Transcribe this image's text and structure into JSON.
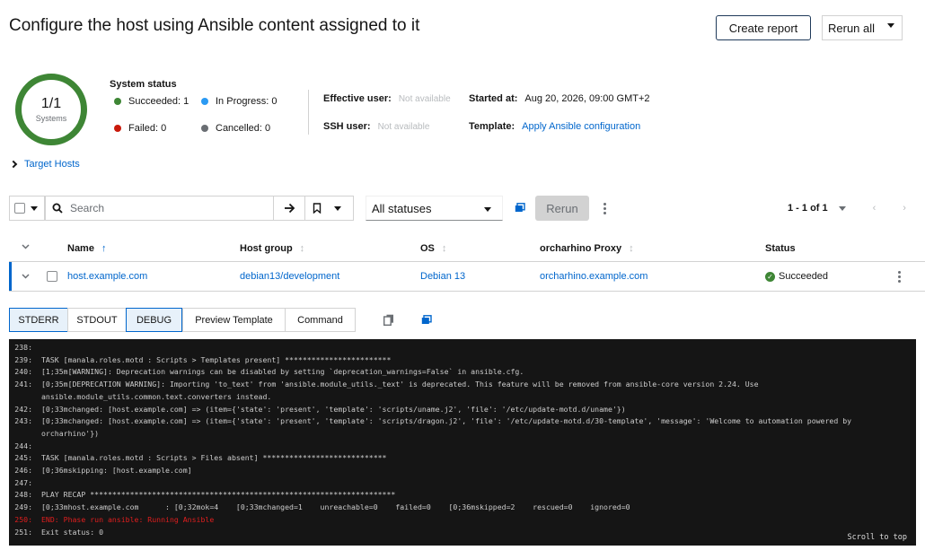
{
  "header": {
    "title": "Configure the host using Ansible content assigned to it",
    "create_report": "Create report",
    "rerun_all": "Rerun all"
  },
  "summary": {
    "donut_value": "1/1",
    "donut_label": "Systems",
    "system_status_title": "System status",
    "succeeded": "Succeeded: 1",
    "in_progress": "In Progress: 0",
    "failed": "Failed: 0",
    "cancelled": "Cancelled: 0",
    "effective_user_label": "Effective user:",
    "effective_user_value": "Not available",
    "ssh_user_label": "SSH user:",
    "ssh_user_value": "Not available",
    "started_at_label": "Started at:",
    "started_at_value": "Aug 20, 2026, 09:00 GMT+2",
    "template_label": "Template:",
    "template_value": "Apply Ansible configuration",
    "colors": {
      "succeeded": "#3e8635",
      "in_progress": "#2b9af3",
      "failed": "#c9190b",
      "cancelled": "#6a6e73"
    }
  },
  "target_hosts": "Target Hosts",
  "toolbar": {
    "search_placeholder": "Search",
    "status_filter": "All statuses",
    "rerun": "Rerun",
    "pagination": "1 - 1 of 1"
  },
  "table": {
    "headers": {
      "name": "Name",
      "host_group": "Host group",
      "os": "OS",
      "proxy": "orcharhino Proxy",
      "status": "Status"
    },
    "rows": [
      {
        "name": "host.example.com",
        "host_group": "debian13/development",
        "os": "Debian 13",
        "proxy": "orcharhino.example.com",
        "status": "Succeeded"
      }
    ]
  },
  "output_tabs": [
    "STDERR",
    "STDOUT",
    "DEBUG",
    "Preview Template",
    "Command"
  ],
  "log": [
    {
      "n": "238:",
      "t": ""
    },
    {
      "n": "239:",
      "t": "TASK [manala.roles.motd : Scripts > Templates present] ************************"
    },
    {
      "n": "240:",
      "t": "[1;35m[WARNING]: Deprecation warnings can be disabled by setting `deprecation_warnings=False` in ansible.cfg."
    },
    {
      "n": "241:",
      "t": "[0;35m[DEPRECATION WARNING]: Importing 'to_text' from 'ansible.module_utils._text' is deprecated. This feature will be removed from ansible-core version 2.24. Use ansible.module_utils.common.text.converters instead."
    },
    {
      "n": "242:",
      "t": "[0;33mchanged: [host.example.com] => (item={'state': 'present', 'template': 'scripts/uname.j2', 'file': '/etc/update-motd.d/uname'})"
    },
    {
      "n": "243:",
      "t": "[0;33mchanged: [host.example.com] => (item={'state': 'present', 'template': 'scripts/dragon.j2', 'file': '/etc/update-motd.d/30-template', 'message': 'Welcome to automation powered by orcharhino'})"
    },
    {
      "n": "244:",
      "t": ""
    },
    {
      "n": "245:",
      "t": "TASK [manala.roles.motd : Scripts > Files absent] ****************************"
    },
    {
      "n": "246:",
      "t": "[0;36mskipping: [host.example.com]"
    },
    {
      "n": "247:",
      "t": ""
    },
    {
      "n": "248:",
      "t": "PLAY RECAP *********************************************************************"
    },
    {
      "n": "249:",
      "t": "[0;33mhost.example.com      : [0;32mok=4    [0;33mchanged=1    unreachable=0    failed=0    [0;36mskipped=2    rescued=0    ignored=0"
    },
    {
      "n": "250:",
      "t": "END: Phase run ansible: Running Ansible",
      "err": true
    },
    {
      "n": "251:",
      "t": "Exit status: 0"
    }
  ],
  "scroll_to_top": "Scroll to top"
}
